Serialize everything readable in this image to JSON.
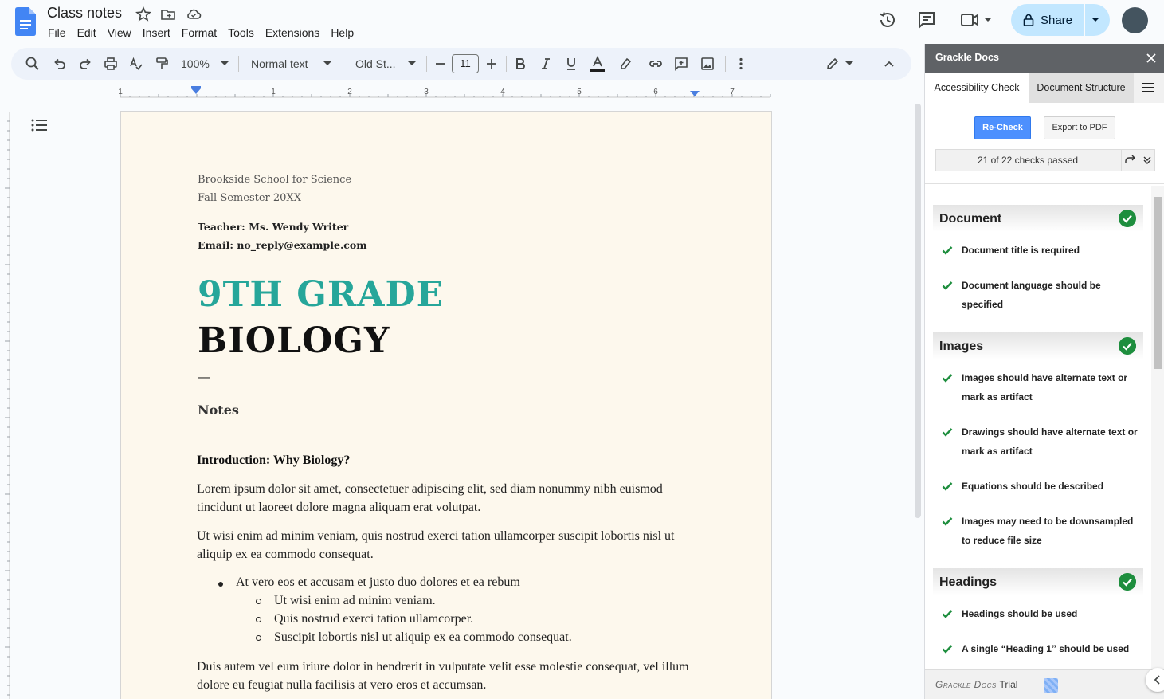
{
  "app": {
    "doc_title": "Class notes",
    "menu": [
      "File",
      "Edit",
      "View",
      "Insert",
      "Format",
      "Tools",
      "Extensions",
      "Help"
    ],
    "share_label": "Share"
  },
  "toolbar": {
    "zoom": "100%",
    "style": "Normal text",
    "font": "Old St...",
    "font_size": "11"
  },
  "ruler": {
    "marks": [
      "1",
      "1",
      "2",
      "3",
      "4",
      "5",
      "6",
      "7"
    ]
  },
  "document": {
    "school": "Brookside School for Science",
    "semester": "Fall Semester 20XX",
    "teacher": "Teacher: Ms. Wendy Writer",
    "email": "Email: no_reply@example.com",
    "title_line1": "9TH GRADE",
    "title_line2": "BIOLOGY",
    "dash": "—",
    "notes_heading": "Notes",
    "intro_heading": "Introduction: Why Biology?",
    "para1": "Lorem ipsum dolor sit amet, consectetuer adipiscing elit, sed diam nonummy nibh euismod tincidunt ut laoreet dolore magna aliquam erat volutpat.",
    "para2": "Ut wisi enim ad minim veniam, quis nostrud exerci tation ullamcorper suscipit lobortis nisl ut aliquip ex ea commodo consequat.",
    "bullet1": "At vero eos et accusam et justo duo dolores et ea rebum",
    "sub_bullets": [
      "Ut wisi enim ad minim veniam.",
      "Quis nostrud exerci tation ullamcorper.",
      "Suscipit lobortis nisl ut aliquip ex ea commodo consequat."
    ],
    "para3": "Duis autem vel eum iriure dolor in hendrerit in vulputate velit esse molestie consequat, vel illum dolore eu feugiat nulla facilisis at vero eros et accumsan."
  },
  "sidebar": {
    "title": "Grackle Docs",
    "tabs": [
      "Accessibility Check",
      "Document Structure"
    ],
    "recheck_label": "Re-Check",
    "export_label": "Export to PDF",
    "checks_status": "21 of 22 checks passed",
    "sections": [
      {
        "title": "Document",
        "items": [
          "Document title is required",
          "Document language should be specified"
        ]
      },
      {
        "title": "Images",
        "items": [
          "Images should have alternate text or mark as artifact",
          "Drawings should have alternate text or mark as artifact",
          "Equations should be described",
          "Images may need to be downsampled to reduce file size"
        ]
      },
      {
        "title": "Headings",
        "items": [
          "Headings should be used",
          "A single “Heading 1” should be used"
        ]
      }
    ],
    "footer_brand": "Grackle Docs",
    "footer_trial": "Trial"
  },
  "colors": {
    "accent_teal": "#26a69a",
    "share_bg": "#c2e7ff",
    "recheck_blue": "#4d90fe",
    "pass_green": "#1e8e3e",
    "page_bg": "#fdf8ed"
  }
}
